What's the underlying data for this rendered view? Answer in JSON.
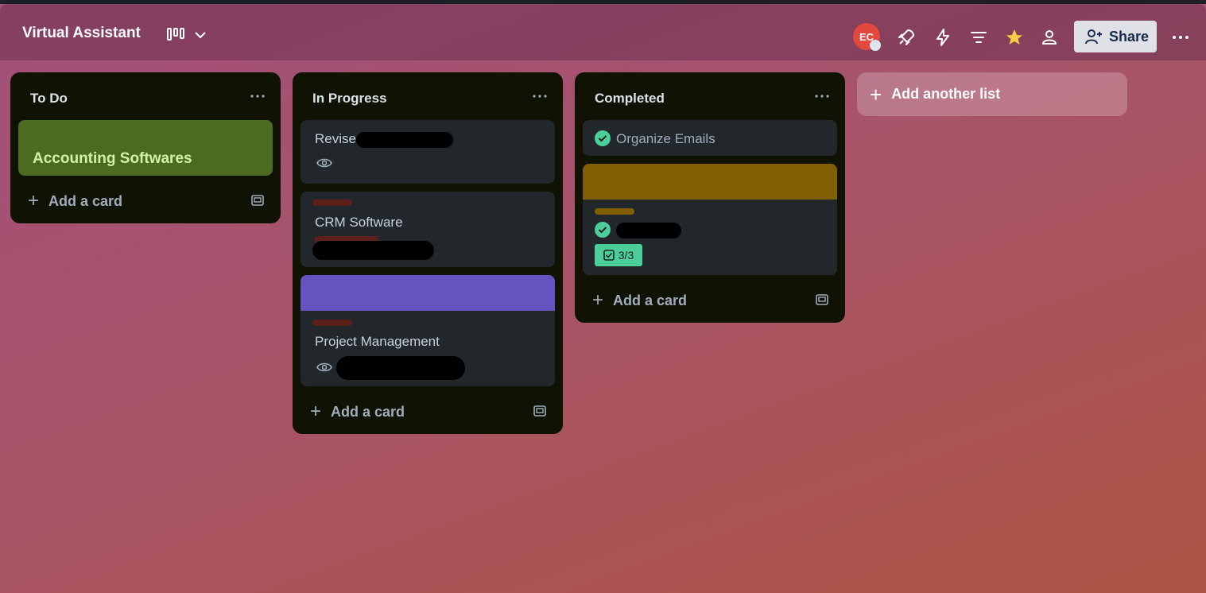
{
  "board": {
    "title": "Virtual Assistant"
  },
  "header": {
    "avatar_initials": "EC",
    "share_label": "Share"
  },
  "lists": [
    {
      "title": "To Do",
      "add_card_label": "Add a card",
      "cards": [
        {
          "title": "Accounting Softwares",
          "cover_color": "#4c6b1f",
          "title_color": "#d3f1a7"
        }
      ]
    },
    {
      "title": "In Progress",
      "add_card_label": "Add a card",
      "cards": [
        {
          "title": "Revise",
          "icons": [
            "eye-icon"
          ]
        },
        {
          "title": "CRM Software",
          "label_color": "#5d1f1a"
        },
        {
          "title": "Project Management",
          "cover_color": "#6554c0",
          "label_color": "#5d1f1a",
          "icons": [
            "eye-icon"
          ]
        }
      ]
    },
    {
      "title": "Completed",
      "add_card_label": "Add a card",
      "cards": [
        {
          "title": "Organize Emails",
          "completed": true
        },
        {
          "cover_color": "#7f5f01",
          "label_color": "#7f5f01",
          "completed": true,
          "checklist": "3/3"
        }
      ]
    }
  ],
  "add_list_label": "Add another list",
  "colors": {
    "check_green": "#4bce97",
    "list_bg": "#101204",
    "card_bg": "#22272b"
  }
}
